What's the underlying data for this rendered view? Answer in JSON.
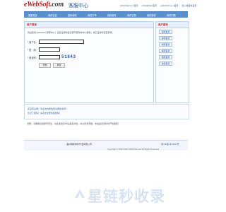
{
  "header": {
    "logo": "eWebSoft",
    "logo_suffix": ".com",
    "subtitle": "客服中心",
    "top_links": [
      "eWebSoft.com首页",
      "eWebEditor首页",
      "eWebSoft.com首页",
      "加入收藏夹首页"
    ]
  },
  "nav": {
    "items": [
      "客服首页",
      "我的信息",
      "密码修改",
      "我的订单",
      "我的软件",
      "我的试用",
      "我的授权",
      "我的问题"
    ]
  },
  "login": {
    "title": "用户登录",
    "intro": "欢迎使用 eWebSoft 客服中心！直接注册新会员即可使用本中心服务，或已注册请直接登录：",
    "username_label": "* 用户名：",
    "password_label": "* 密　码：",
    "captcha_label": "* 验证码：",
    "captcha_code": "51843",
    "login_button": "登录",
    "reset_button": "重置"
  },
  "notes": {
    "line1": "还没有注册？请点击这里免费注册新会员！",
    "line2": "忘记了密码？请点击这里找回密码！",
    "info": "说明：为确保您的账号安全，请在使用完毕后退出系统，并关闭浏览器。本站会员资料将严格保密！"
  },
  "sidebar": {
    "title": "用户服务",
    "items": [
      "客服首页",
      "客服首页",
      "客服首页",
      "客服首页",
      "客服首页",
      "客服首页"
    ]
  },
  "footer": {
    "left": "",
    "company": "温州网新软件开发有限公司",
    "copyright": "Copyright © 2002-2022 eWebSoft.com All Rights Reserved",
    "link": "浙ICP备1234567号"
  },
  "watermark": {
    "text": "星链秒收录"
  },
  "colors": {
    "brand_red": "#c21a1a",
    "nav_blue": "#5a8fcf",
    "link_blue": "#2f5ea5",
    "panel_border": "#bcd0ea"
  }
}
